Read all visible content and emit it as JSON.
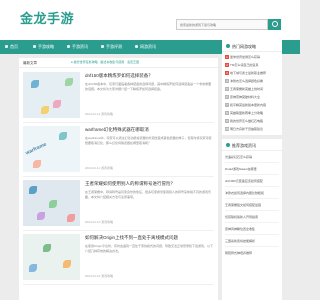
{
  "site": {
    "logo": "金龙手游"
  },
  "search": {
    "placeholder": "搜索最新的游戏下载与攻略"
  },
  "nav": {
    "items": [
      "首页",
      "手游攻略",
      "手游资讯",
      "手游评测",
      "网游资讯"
    ]
  },
  "main": {
    "crumb": "最新文章",
    "sub_crumb": "● 魔兽世界任务攻略  ·  魔法书收集与使用  ·  洛克王国",
    "articles": [
      {
        "thumb_caption": "",
        "title": "dnf150版本精炼罗如何选择装备？",
        "body": "在dnf150版本中，玩家们面临着各种装备的选择问题，其中精炼罗如何选择装备是一个非常重要的话题。本文将为大家详细介绍一下精炼罗如何选择装备。",
        "meta": "2024-01-11  游戏攻略"
      },
      {
        "thumb_caption": "warframe",
        "title": "warframe幻化特殊武器在哪取消",
        "body": "在warframe中，玩家可以通过幻化功能将武器的外观改变成其他武器的样子，但有时候玩家可能想要取消幻化，那么幻化特殊武器在哪里取消呢？",
        "meta": "2024-01-11  游戏攻略"
      },
      {
        "thumb_caption": "",
        "title": "王者荣耀如何使用别人的称谓称号进行冒险？",
        "body": "在王者荣耀中，称谓称号是玩家身份的象征，很多玩家希望使用别人的称号来体验不同的游戏乐趣，本文将介绍相关方法与注意事项。",
        "meta": "2024-01-10  游戏攻略"
      },
      {
        "thumb_caption": "",
        "title": "如何解决Origin上找不到一直处于离线模式问题",
        "body": "在使用Origin平台时，有时会遇到一直处于离线模式的问题，导致无法正常登录和下载游戏，以下介绍几种有效的解决办法。",
        "meta": "2024-01-10  游戏攻略"
      }
    ]
  },
  "side": {
    "hot_title": "热门网游攻略",
    "hot_items": [
      "迷你世界坐骑怎么获得",
      "Tf2怎么领自己的道具",
      "地下城与勇士最新职业推荐",
      "冲锋衣怎么选择颜色好看",
      "王者荣耀新英雄上线时间",
      "原神雷神突破材料大全",
      "和平精英最新版本更新内容",
      "英雄联盟新赛季上分攻略",
      "我的世界怎么做红石电路",
      "明日方舟新干员抽取建议"
    ],
    "rec_title": "推荐游戏资讯",
    "rec_items": [
      "光遇彩虹石怎么获得",
      "Dota2游戏Steam在哪里",
      "dnf1000元装备应该如何搭配",
      "冲锋衣如何选择内胆比较暖和",
      "王者荣耀铭文如何搭配最强",
      "饥荒联机版新人开局指南",
      "原神风神瞳位置全收集",
      "三国杀新武将技能解析",
      "阴阳师式神培养推荐"
    ]
  },
  "colors": {
    "accent": "#2a9d8f",
    "hot_rank": "#e74c3c"
  }
}
